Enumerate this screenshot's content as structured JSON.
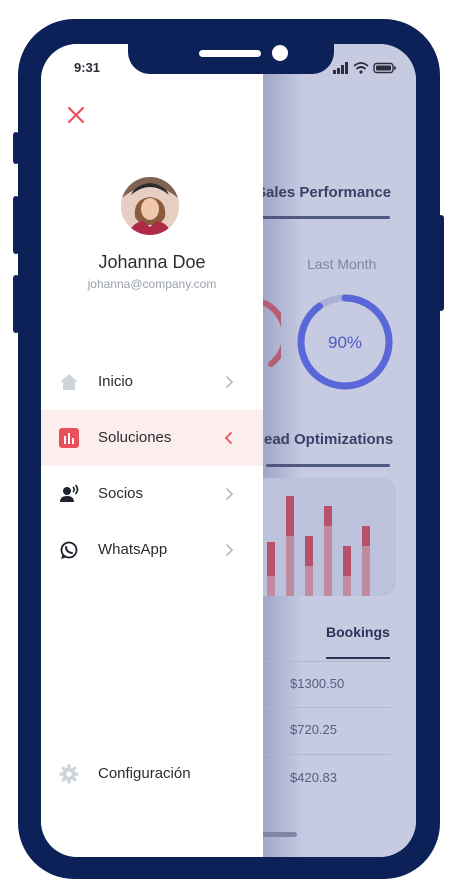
{
  "status_bar": {
    "time": "9:31"
  },
  "user": {
    "name": "Johanna Doe",
    "email": "johanna@company.com"
  },
  "menu": {
    "items": [
      {
        "label": "Inicio",
        "icon": "home-icon",
        "active": false
      },
      {
        "label": "Soluciones",
        "icon": "bar-chart-icon",
        "active": true
      },
      {
        "label": "Socios",
        "icon": "partners-icon",
        "active": false
      },
      {
        "label": "WhatsApp",
        "icon": "whatsapp-icon",
        "active": false
      }
    ],
    "settings_label": "Configuración"
  },
  "background": {
    "sales_performance": {
      "title": "Sales Performance",
      "period": "Last Month",
      "progress_percent": 90,
      "progress_label": "90%"
    },
    "lead_optimizations": {
      "title": "ead Optimizations",
      "bars": [
        {
          "top": 0.34,
          "bottom": 0.2
        },
        {
          "top": 0.4,
          "bottom": 0.6
        },
        {
          "top": 0.3,
          "bottom": 0.3
        },
        {
          "top": 0.2,
          "bottom": 0.7
        },
        {
          "top": 0.3,
          "bottom": 0.2
        },
        {
          "top": 0.2,
          "bottom": 0.5
        }
      ]
    },
    "bookings": {
      "title": "Bookings",
      "amounts": [
        "$1300.50",
        "$720.25",
        "$420.83"
      ]
    }
  },
  "colors": {
    "frame": "#0c2157",
    "accent": "#e8505b",
    "active_bg": "#fdeeee",
    "ring": "#5a67d8",
    "bar_top": "#b6506b",
    "bar_bottom": "#c08aa0"
  }
}
